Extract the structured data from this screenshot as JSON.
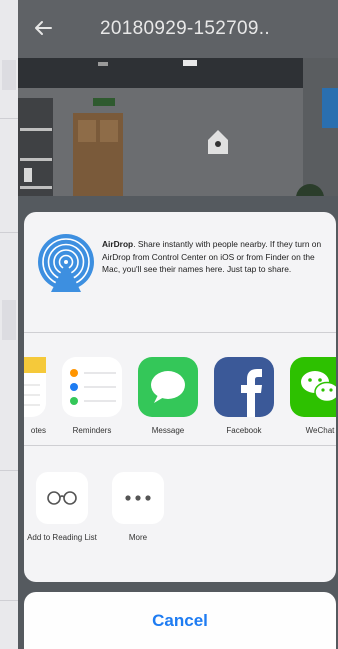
{
  "header": {
    "back_icon": "arrow-left-icon",
    "title": "20180929-152709.."
  },
  "airdrop": {
    "icon": "airdrop-icon",
    "name": "AirDrop",
    "description": ". Share instantly with people nearby. If they turn on AirDrop from Control Center on iOS or from Finder on the Mac, you'll see their names here. Just tap to share."
  },
  "apps": [
    {
      "label": "otes",
      "icon": "notes-icon"
    },
    {
      "label": "Reminders",
      "icon": "reminders-icon"
    },
    {
      "label": "Message",
      "icon": "message-icon",
      "color": "#34c759"
    },
    {
      "label": "Facebook",
      "icon": "facebook-icon",
      "color": "#3b5998"
    },
    {
      "label": "WeChat",
      "icon": "wechat-icon",
      "color": "#2dc100"
    }
  ],
  "actions": [
    {
      "label": "Add to Reading List",
      "icon": "glasses-icon"
    },
    {
      "label": "More",
      "icon": "more-icon"
    }
  ],
  "cancel_label": "Cancel",
  "colors": {
    "accent": "#1e7cf2",
    "header_bg": "#5f6266",
    "sheet_bg": "#f4f4f6"
  }
}
